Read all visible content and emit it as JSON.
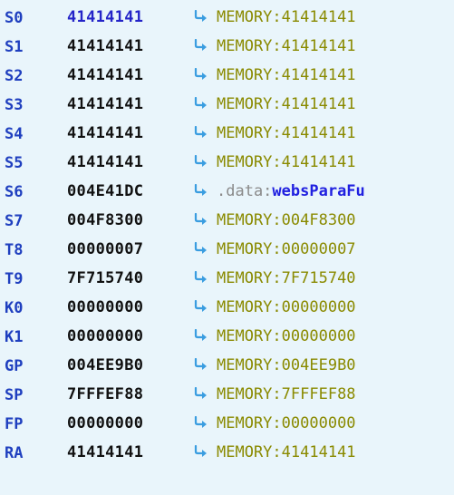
{
  "registers": [
    {
      "name": "S0",
      "value": "41414141",
      "segment": "MEMORY:",
      "symbol": "41414141"
    },
    {
      "name": "S1",
      "value": "41414141",
      "segment": "MEMORY:",
      "symbol": "41414141"
    },
    {
      "name": "S2",
      "value": "41414141",
      "segment": "MEMORY:",
      "symbol": "41414141"
    },
    {
      "name": "S3",
      "value": "41414141",
      "segment": "MEMORY:",
      "symbol": "41414141"
    },
    {
      "name": "S4",
      "value": "41414141",
      "segment": "MEMORY:",
      "symbol": "41414141"
    },
    {
      "name": "S5",
      "value": "41414141",
      "segment": "MEMORY:",
      "symbol": "41414141"
    },
    {
      "name": "S6",
      "value": "004E41DC",
      "segment": ".data:",
      "symbol": "websParaFu"
    },
    {
      "name": "S7",
      "value": "004F8300",
      "segment": "MEMORY:",
      "symbol": "004F8300"
    },
    {
      "name": "T8",
      "value": "00000007",
      "segment": "MEMORY:",
      "symbol": "00000007"
    },
    {
      "name": "T9",
      "value": "7F715740",
      "segment": "MEMORY:",
      "symbol": "7F715740"
    },
    {
      "name": "K0",
      "value": "00000000",
      "segment": "MEMORY:",
      "symbol": "00000000"
    },
    {
      "name": "K1",
      "value": "00000000",
      "segment": "MEMORY:",
      "symbol": "00000000"
    },
    {
      "name": "GP",
      "value": "004EE9B0",
      "segment": "MEMORY:",
      "symbol": "004EE9B0"
    },
    {
      "name": "SP",
      "value": "7FFFEF88",
      "segment": "MEMORY:",
      "symbol": "7FFFEF88"
    },
    {
      "name": "FP",
      "value": "00000000",
      "segment": "MEMORY:",
      "symbol": "00000000"
    },
    {
      "name": "RA",
      "value": "41414141",
      "segment": "MEMORY:",
      "symbol": "41414141"
    }
  ],
  "icons": {
    "jump_arrow": "jump-arrow-icon"
  },
  "colors": {
    "background": "#e9f5fb",
    "register_name": "#1f3fbf",
    "value": "#111111",
    "value_first": "#2424c8",
    "segment": "#8a8a00",
    "data_segment": "#8a8a8a",
    "symbol": "#2020e0",
    "arrow": "#3a9de0"
  }
}
